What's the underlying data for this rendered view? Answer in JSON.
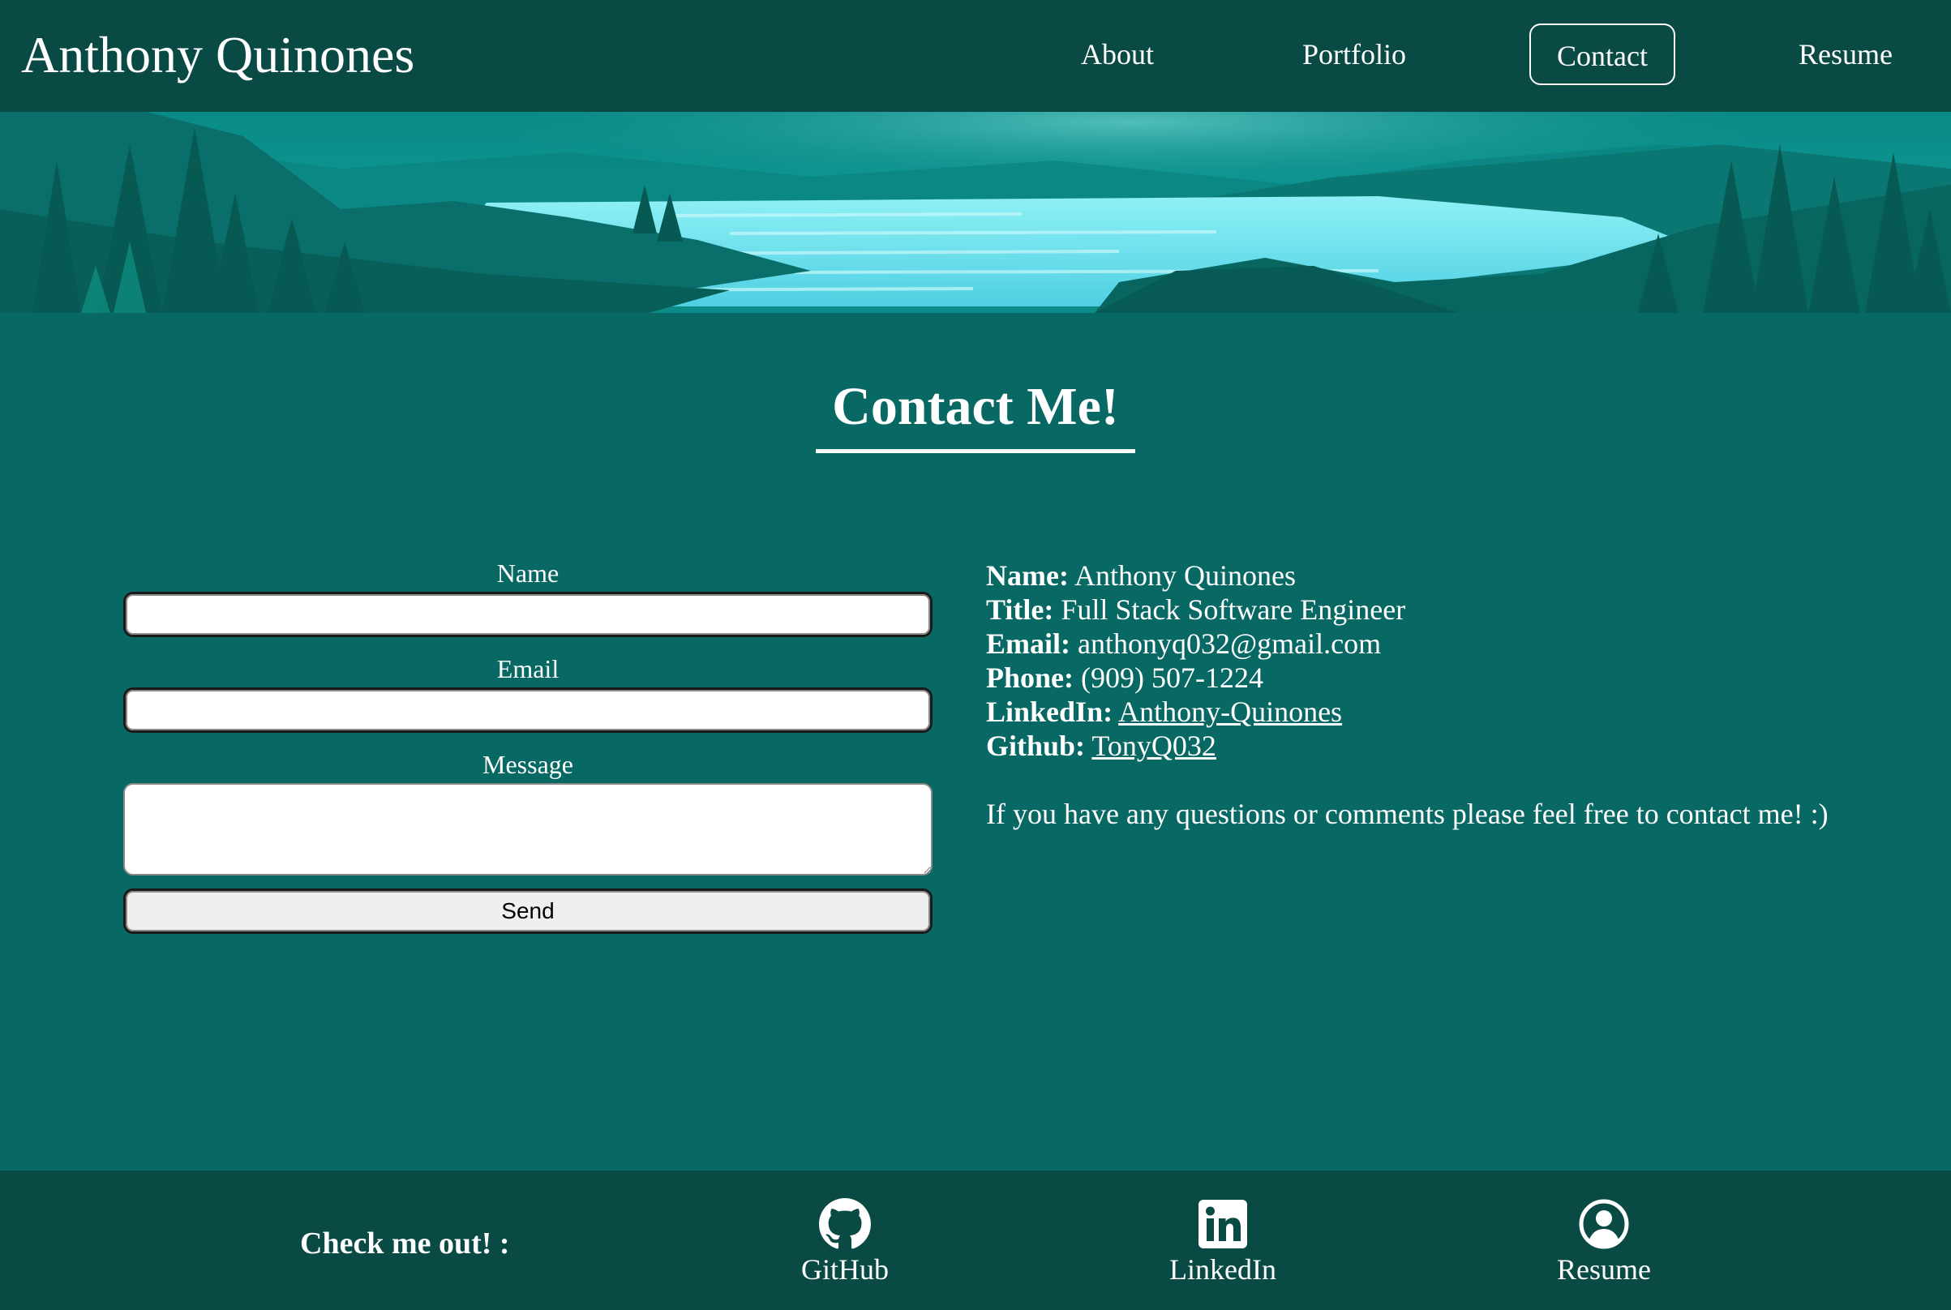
{
  "header": {
    "brand": "Anthony Quinones",
    "nav": [
      {
        "label": "About"
      },
      {
        "label": "Portfolio"
      },
      {
        "label": "Contact",
        "active": true
      },
      {
        "label": "Resume"
      }
    ]
  },
  "main": {
    "heading": "Contact Me!",
    "form": {
      "name_label": "Name",
      "name_value": "",
      "email_label": "Email",
      "email_value": "",
      "message_label": "Message",
      "message_value": "",
      "send_label": "Send"
    },
    "info": {
      "name_key": "Name:",
      "name_value": "Anthony Quinones",
      "title_key": "Title:",
      "title_value": "Full Stack Software Engineer",
      "email_key": "Email:",
      "email_value": "anthonyq032@gmail.com",
      "phone_key": "Phone:",
      "phone_value": "(909) 507-1224",
      "linkedin_key": "LinkedIn:",
      "linkedin_value": "Anthony-Quinones",
      "github_key": "Github:",
      "github_value": "TonyQ032",
      "note": "If you have any questions or comments please feel free to contact me! :)"
    }
  },
  "footer": {
    "title": "Check me out! :",
    "links": [
      {
        "label": "GitHub",
        "icon": "github-icon"
      },
      {
        "label": "LinkedIn",
        "icon": "linkedin-icon"
      },
      {
        "label": "Resume",
        "icon": "user-circle-icon"
      }
    ]
  },
  "colors": {
    "page_background": "#076864",
    "header_background": "#094a44",
    "footer_background": "#094a44",
    "text": "#ffffff",
    "banner_water": "#7ee6f0"
  }
}
